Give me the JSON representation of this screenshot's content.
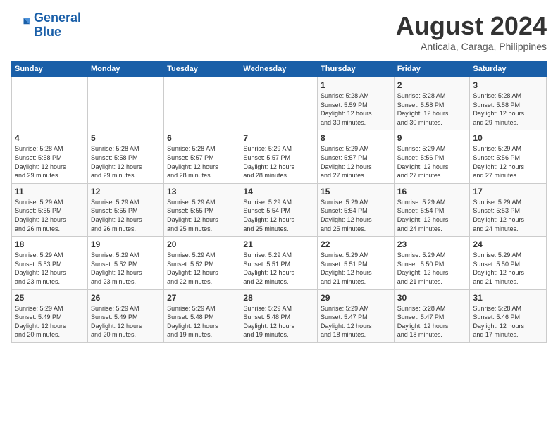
{
  "header": {
    "logo_line1": "General",
    "logo_line2": "Blue",
    "month_year": "August 2024",
    "location": "Anticala, Caraga, Philippines"
  },
  "days_of_week": [
    "Sunday",
    "Monday",
    "Tuesday",
    "Wednesday",
    "Thursday",
    "Friday",
    "Saturday"
  ],
  "weeks": [
    [
      {
        "day": "",
        "info": ""
      },
      {
        "day": "",
        "info": ""
      },
      {
        "day": "",
        "info": ""
      },
      {
        "day": "",
        "info": ""
      },
      {
        "day": "1",
        "info": "Sunrise: 5:28 AM\nSunset: 5:59 PM\nDaylight: 12 hours\nand 30 minutes."
      },
      {
        "day": "2",
        "info": "Sunrise: 5:28 AM\nSunset: 5:58 PM\nDaylight: 12 hours\nand 30 minutes."
      },
      {
        "day": "3",
        "info": "Sunrise: 5:28 AM\nSunset: 5:58 PM\nDaylight: 12 hours\nand 29 minutes."
      }
    ],
    [
      {
        "day": "4",
        "info": "Sunrise: 5:28 AM\nSunset: 5:58 PM\nDaylight: 12 hours\nand 29 minutes."
      },
      {
        "day": "5",
        "info": "Sunrise: 5:28 AM\nSunset: 5:58 PM\nDaylight: 12 hours\nand 29 minutes."
      },
      {
        "day": "6",
        "info": "Sunrise: 5:28 AM\nSunset: 5:57 PM\nDaylight: 12 hours\nand 28 minutes."
      },
      {
        "day": "7",
        "info": "Sunrise: 5:29 AM\nSunset: 5:57 PM\nDaylight: 12 hours\nand 28 minutes."
      },
      {
        "day": "8",
        "info": "Sunrise: 5:29 AM\nSunset: 5:57 PM\nDaylight: 12 hours\nand 27 minutes."
      },
      {
        "day": "9",
        "info": "Sunrise: 5:29 AM\nSunset: 5:56 PM\nDaylight: 12 hours\nand 27 minutes."
      },
      {
        "day": "10",
        "info": "Sunrise: 5:29 AM\nSunset: 5:56 PM\nDaylight: 12 hours\nand 27 minutes."
      }
    ],
    [
      {
        "day": "11",
        "info": "Sunrise: 5:29 AM\nSunset: 5:55 PM\nDaylight: 12 hours\nand 26 minutes."
      },
      {
        "day": "12",
        "info": "Sunrise: 5:29 AM\nSunset: 5:55 PM\nDaylight: 12 hours\nand 26 minutes."
      },
      {
        "day": "13",
        "info": "Sunrise: 5:29 AM\nSunset: 5:55 PM\nDaylight: 12 hours\nand 25 minutes."
      },
      {
        "day": "14",
        "info": "Sunrise: 5:29 AM\nSunset: 5:54 PM\nDaylight: 12 hours\nand 25 minutes."
      },
      {
        "day": "15",
        "info": "Sunrise: 5:29 AM\nSunset: 5:54 PM\nDaylight: 12 hours\nand 25 minutes."
      },
      {
        "day": "16",
        "info": "Sunrise: 5:29 AM\nSunset: 5:54 PM\nDaylight: 12 hours\nand 24 minutes."
      },
      {
        "day": "17",
        "info": "Sunrise: 5:29 AM\nSunset: 5:53 PM\nDaylight: 12 hours\nand 24 minutes."
      }
    ],
    [
      {
        "day": "18",
        "info": "Sunrise: 5:29 AM\nSunset: 5:53 PM\nDaylight: 12 hours\nand 23 minutes."
      },
      {
        "day": "19",
        "info": "Sunrise: 5:29 AM\nSunset: 5:52 PM\nDaylight: 12 hours\nand 23 minutes."
      },
      {
        "day": "20",
        "info": "Sunrise: 5:29 AM\nSunset: 5:52 PM\nDaylight: 12 hours\nand 22 minutes."
      },
      {
        "day": "21",
        "info": "Sunrise: 5:29 AM\nSunset: 5:51 PM\nDaylight: 12 hours\nand 22 minutes."
      },
      {
        "day": "22",
        "info": "Sunrise: 5:29 AM\nSunset: 5:51 PM\nDaylight: 12 hours\nand 21 minutes."
      },
      {
        "day": "23",
        "info": "Sunrise: 5:29 AM\nSunset: 5:50 PM\nDaylight: 12 hours\nand 21 minutes."
      },
      {
        "day": "24",
        "info": "Sunrise: 5:29 AM\nSunset: 5:50 PM\nDaylight: 12 hours\nand 21 minutes."
      }
    ],
    [
      {
        "day": "25",
        "info": "Sunrise: 5:29 AM\nSunset: 5:49 PM\nDaylight: 12 hours\nand 20 minutes."
      },
      {
        "day": "26",
        "info": "Sunrise: 5:29 AM\nSunset: 5:49 PM\nDaylight: 12 hours\nand 20 minutes."
      },
      {
        "day": "27",
        "info": "Sunrise: 5:29 AM\nSunset: 5:48 PM\nDaylight: 12 hours\nand 19 minutes."
      },
      {
        "day": "28",
        "info": "Sunrise: 5:29 AM\nSunset: 5:48 PM\nDaylight: 12 hours\nand 19 minutes."
      },
      {
        "day": "29",
        "info": "Sunrise: 5:29 AM\nSunset: 5:47 PM\nDaylight: 12 hours\nand 18 minutes."
      },
      {
        "day": "30",
        "info": "Sunrise: 5:28 AM\nSunset: 5:47 PM\nDaylight: 12 hours\nand 18 minutes."
      },
      {
        "day": "31",
        "info": "Sunrise: 5:28 AM\nSunset: 5:46 PM\nDaylight: 12 hours\nand 17 minutes."
      }
    ]
  ]
}
